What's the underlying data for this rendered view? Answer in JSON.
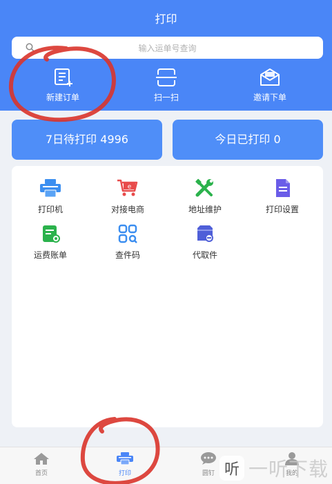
{
  "header": {
    "title": "打印",
    "search_placeholder": "输入运单号查询"
  },
  "quick_actions": [
    {
      "label": "新建订单",
      "icon": "new-order-icon"
    },
    {
      "label": "扫一扫",
      "icon": "scan-icon"
    },
    {
      "label": "邀请下单",
      "icon": "invite-order-icon"
    }
  ],
  "stats": {
    "pending": "7日待打印  4996",
    "printed_today": "今日已打印  0"
  },
  "tools": [
    {
      "label": "打印机",
      "icon": "printer-icon",
      "color": "#3b8ef0"
    },
    {
      "label": "对接电商",
      "icon": "cart-icon",
      "color": "#e84b4b"
    },
    {
      "label": "地址维护",
      "icon": "wrench-icon",
      "color": "#2bb24c"
    },
    {
      "label": "打印设置",
      "icon": "doc-settings-icon",
      "color": "#6a5ce8"
    },
    {
      "label": "运费账单",
      "icon": "bill-icon",
      "color": "#2bb24c"
    },
    {
      "label": "查件码",
      "icon": "qr-icon",
      "color": "#3b8ef0"
    },
    {
      "label": "代取件",
      "icon": "pickup-icon",
      "color": "#4f5fd8"
    }
  ],
  "tabs": [
    {
      "label": "首页",
      "icon": "home-icon"
    },
    {
      "label": "打印",
      "icon": "printer-icon"
    },
    {
      "label": "圆钉",
      "icon": "chat-icon"
    },
    {
      "label": "我的",
      "icon": "user-icon"
    }
  ],
  "watermark": {
    "mark": "听",
    "text": "一听下载"
  },
  "colors": {
    "brand": "#4a86f7",
    "annotation": "#d9342b"
  }
}
